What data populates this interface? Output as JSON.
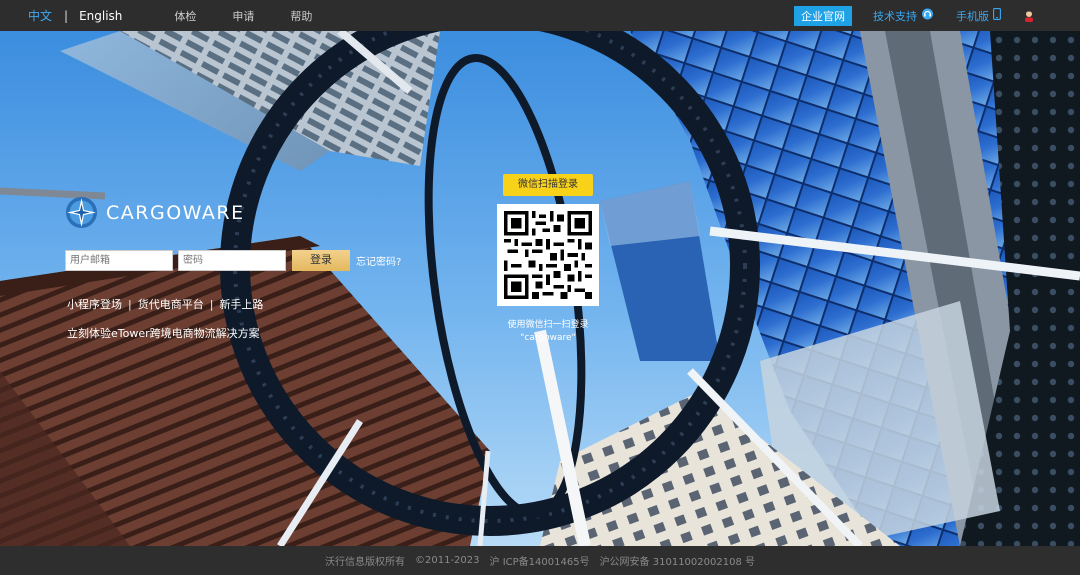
{
  "topbar": {
    "lang_zh": "中文",
    "lang_sep": "|",
    "lang_en": "English",
    "nav": [
      "体检",
      "申请",
      "帮助"
    ],
    "enterprise_label": "企业官网",
    "support_label": "技术支持",
    "mobile_label": "手机版"
  },
  "brand": {
    "name": "CARGOWARE"
  },
  "login": {
    "username_placeholder": "用户邮箱",
    "password_placeholder": "密码",
    "login_label": "登录",
    "forgot_label": "忘记密码?"
  },
  "links": {
    "miniapp": "小程序登场",
    "sep": "|",
    "platform": "货代电商平台",
    "newbie": "新手上路",
    "promo": "立刻体验eTower跨境电商物流解决方案"
  },
  "qr": {
    "badge": "微信扫描登录",
    "hint_line1": "使用微信扫一扫登录",
    "hint_line2": "\"cargoware\""
  },
  "footer": {
    "company": "沃行信息版权所有",
    "copyright": "©2011-2023",
    "icp": "沪 ICP备14001465号",
    "police": "沪公网安备 31011002002108 号"
  },
  "colors": {
    "accent": "#1fa1e6",
    "link_blue": "#39a9f3",
    "login_gold": "#e4b85f",
    "wechat_badge": "#f8d119",
    "bar_bg": "#2d2d2d"
  }
}
